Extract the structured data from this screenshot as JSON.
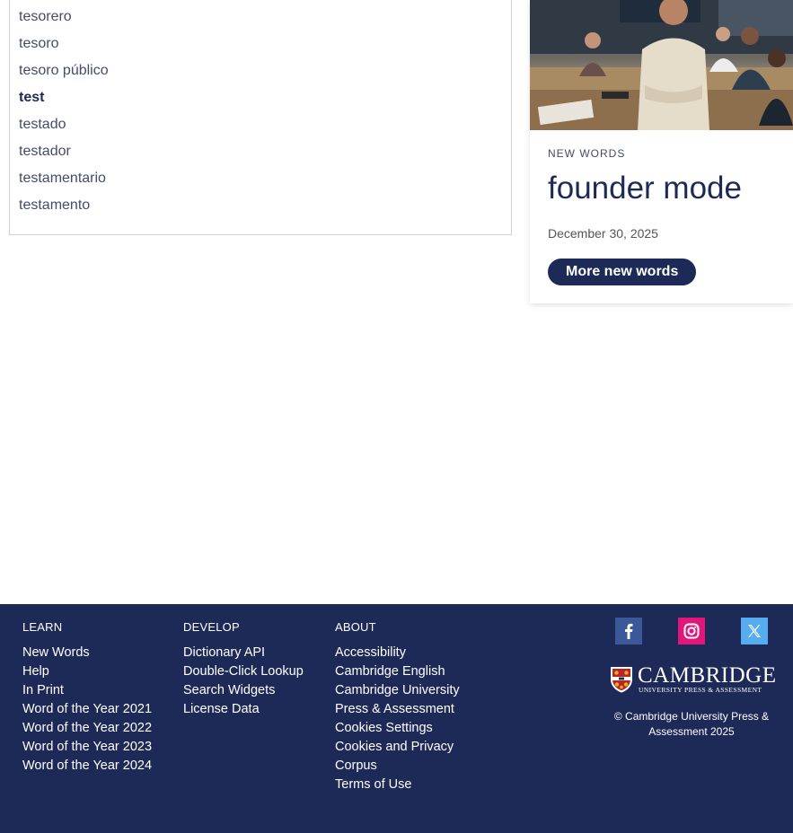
{
  "word_list": {
    "items": [
      {
        "label": "tesorero",
        "current": false
      },
      {
        "label": "tesoro",
        "current": false
      },
      {
        "label": "tesoro público",
        "current": false
      },
      {
        "label": "test",
        "current": true
      },
      {
        "label": "testado",
        "current": false
      },
      {
        "label": "testador",
        "current": false
      },
      {
        "label": "testamentario",
        "current": false
      },
      {
        "label": "testamento",
        "current": false
      }
    ]
  },
  "new_words_card": {
    "kicker": "NEW WORDS",
    "title": "founder mode",
    "date": "December 30, 2025",
    "button_label": "More new words"
  },
  "footer": {
    "learn": {
      "heading": "LEARN",
      "links": [
        "New Words",
        "Help",
        "In Print",
        "Word of the Year 2021",
        "Word of the Year 2022",
        "Word of the Year 2023",
        "Word of the Year 2024"
      ]
    },
    "develop": {
      "heading": "DEVELOP",
      "links": [
        "Dictionary API",
        "Double-Click Lookup",
        "Search Widgets",
        "License Data"
      ]
    },
    "about": {
      "heading": "ABOUT",
      "links": [
        "Accessibility",
        "Cambridge English",
        "Cambridge University",
        "Press & Assessment",
        "Cookies Settings",
        "Cookies and Privacy",
        "Corpus",
        "Terms of Use"
      ]
    },
    "social": {
      "facebook_icon": "facebook-icon",
      "instagram_icon": "instagram-icon",
      "x_icon": "x-icon"
    },
    "logo": {
      "name": "CAMBRIDGE",
      "subtitle": "UNIVERSITY PRESS & ASSESSMENT"
    },
    "copyright": "© Cambridge University Press & Assessment 2025"
  },
  "colors": {
    "navy": "#1d2a57",
    "facebook": "#3b5998",
    "instagram": "#e1157a",
    "x": "#55acee"
  }
}
